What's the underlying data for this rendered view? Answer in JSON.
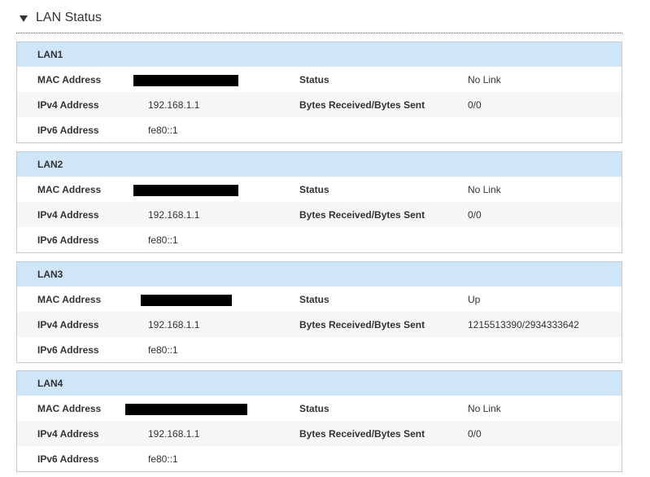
{
  "section": {
    "title": "LAN Status"
  },
  "labels": {
    "mac": "MAC Address",
    "ipv4": "IPv4 Address",
    "ipv6": "IPv6 Address",
    "status": "Status",
    "bytes": "Bytes Received/Bytes Sent"
  },
  "ports": [
    {
      "name": "LAN1",
      "status": "No Link",
      "ipv4": "192.168.1.1",
      "bytes": "0/0",
      "ipv6": "fe80::1"
    },
    {
      "name": "LAN2",
      "status": "No Link",
      "ipv4": "192.168.1.1",
      "bytes": "0/0",
      "ipv6": "fe80::1"
    },
    {
      "name": "LAN3",
      "status": "Up",
      "ipv4": "192.168.1.1",
      "bytes": "1215513390/2934333642",
      "ipv6": "fe80::1"
    },
    {
      "name": "LAN4",
      "status": "No Link",
      "ipv4": "192.168.1.1",
      "bytes": "0/0",
      "ipv6": "fe80::1"
    }
  ],
  "colors": {
    "header_bg": "#cfe6f8",
    "row_alt_bg": "#f6f6f6",
    "border": "#c8c8c8",
    "redaction": "#000000"
  }
}
